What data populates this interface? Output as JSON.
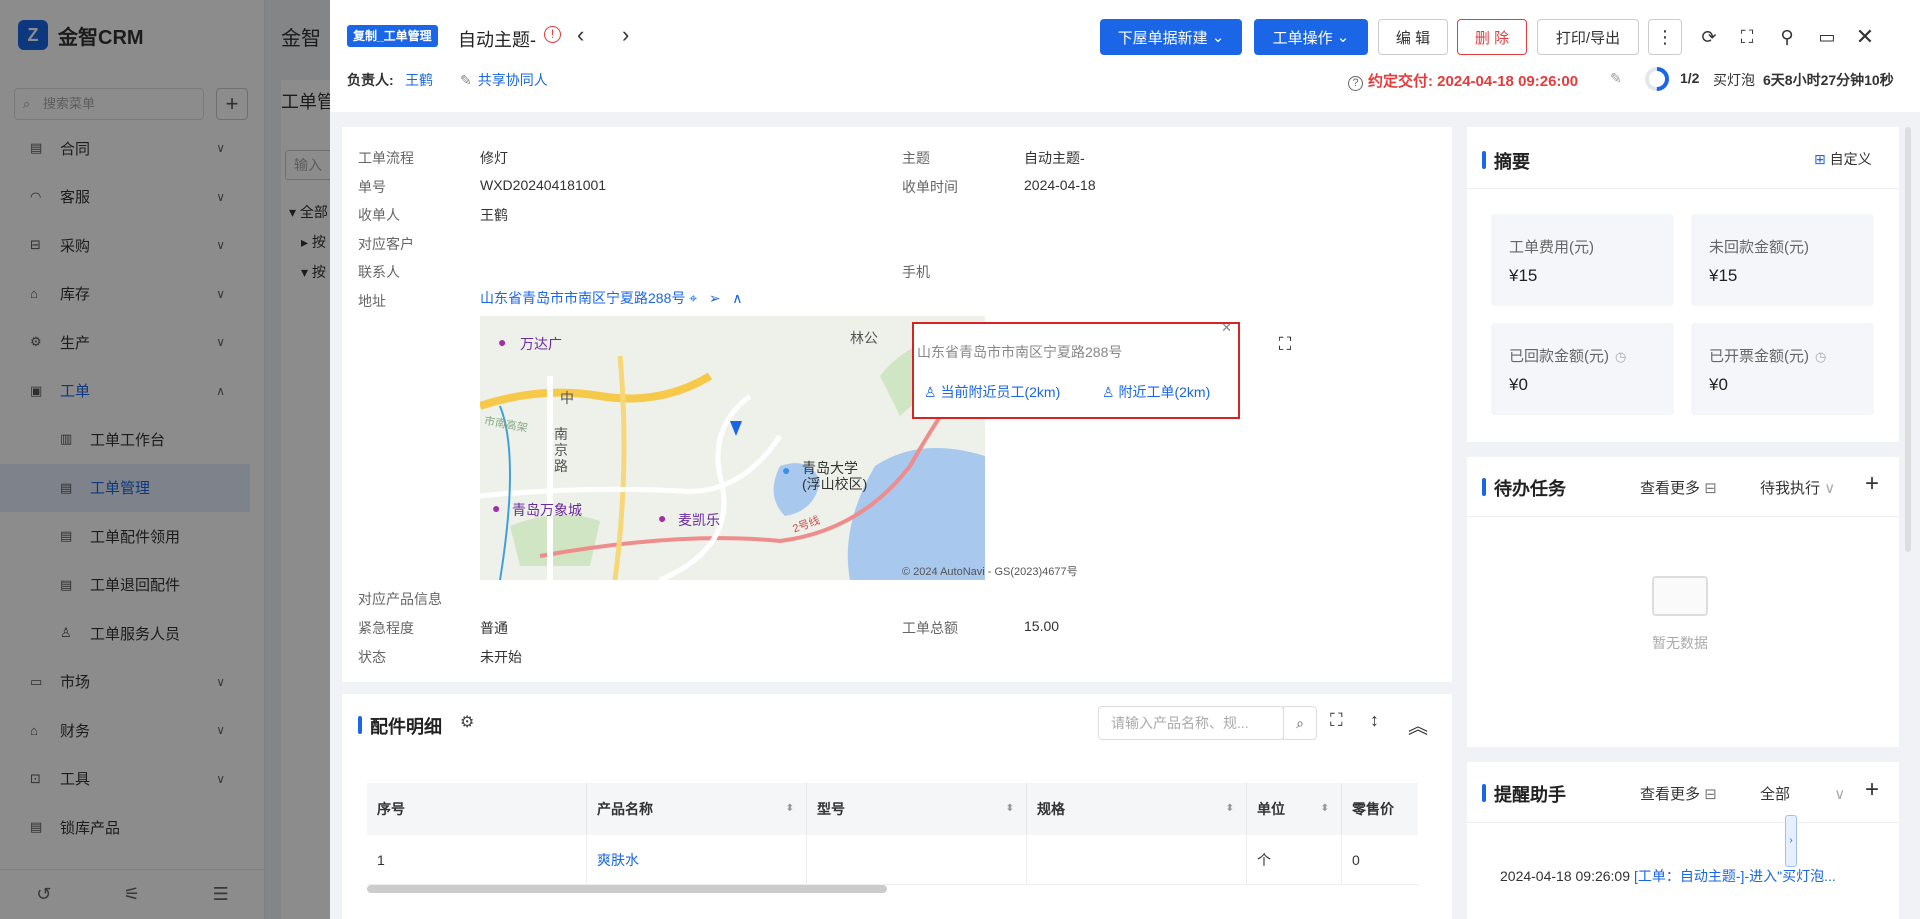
{
  "app": {
    "logo_text": "金智CRM",
    "logo_letter": "Z",
    "search_placeholder": "搜索菜单"
  },
  "sidebar": {
    "items": [
      {
        "label": "合同",
        "icon": "contract-icon"
      },
      {
        "label": "客服",
        "icon": "headset-icon"
      },
      {
        "label": "采购",
        "icon": "cart-icon"
      },
      {
        "label": "库存",
        "icon": "warehouse-icon"
      },
      {
        "label": "生产",
        "icon": "gear-icon"
      },
      {
        "label": "工单",
        "icon": "workorder-icon"
      },
      {
        "label": "工单工作台",
        "icon": "workbench-icon"
      },
      {
        "label": "工单管理",
        "icon": "doc-icon"
      },
      {
        "label": "工单配件领用",
        "icon": "parts-icon"
      },
      {
        "label": "工单退回配件",
        "icon": "return-icon"
      },
      {
        "label": "工单服务人员",
        "icon": "person-icon"
      },
      {
        "label": "市场",
        "icon": "market-icon"
      },
      {
        "label": "财务",
        "icon": "finance-icon"
      },
      {
        "label": "工具",
        "icon": "toolbox-icon"
      },
      {
        "label": "锁库产品",
        "icon": "lock-icon"
      }
    ]
  },
  "background": {
    "title": "工单管",
    "header_cut": "金智",
    "tree_input": "输入",
    "tree_all": "全部",
    "tree_a": "按",
    "tree_b": "按"
  },
  "drawer": {
    "tag": "复制_工单管理",
    "title": "自动主题-",
    "owner_label": "负责人:",
    "owner_name": "王鹤",
    "share_label": "共享协同人",
    "buttons": {
      "new_below": "下屋单据新建",
      "ops": "工单操作",
      "edit": "编 辑",
      "delete": "删 除",
      "print": "打印/导出"
    },
    "due_label": "约定交付:",
    "due_value": "2024-04-18 09:26:00",
    "progress": {
      "text": "1/2",
      "stage": "买灯泡",
      "time": "6天8小时27分钟10秒",
      "fraction": 0.5
    }
  },
  "info": {
    "fields": {
      "flow_label": "工单流程",
      "flow_value": "修灯",
      "subject_label": "主题",
      "subject_value": "自动主题-",
      "no_label": "单号",
      "no_value": "WXD202404181001",
      "recv_time_label": "收单时间",
      "recv_time_value": "2024-04-18",
      "receiver_label": "收单人",
      "receiver_value": "王鹤",
      "customer_label": "对应客户",
      "contact_label": "联系人",
      "phone_label": "手机",
      "address_label": "地址",
      "address_value": "山东省青岛市市南区宁夏路288号",
      "product_label": "对应产品信息",
      "urgency_label": "紧急程度",
      "urgency_value": "普通",
      "total_label": "工单总额",
      "total_value": "15.00",
      "status_label": "状态",
      "status_value": "未开始"
    },
    "map": {
      "popup_address": "山东省青岛市市南区宁夏路288号",
      "nearby_staff": "当前附近员工(2km)",
      "nearby_orders": "附近工单(2km)",
      "copyright": "© 2024 AutoNavi - GS(2023)4677号",
      "labels": {
        "wanda": "万达广",
        "zhong": "中",
        "lin": "林公",
        "nanjing_rd": "南京路",
        "qdu": "青岛大学",
        "qdu_sub": "(浮山校区)",
        "wanxiang": "青岛万象城",
        "maikaile": "麦凯乐",
        "line2": "2号线",
        "east": "市南高架"
      }
    }
  },
  "parts": {
    "title": "配件明细",
    "search_placeholder": "请输入产品名称、规...",
    "columns": [
      "序号",
      "产品名称",
      "型号",
      "规格",
      "单位",
      "零售价"
    ],
    "rows": [
      [
        "1",
        "爽肤水",
        "",
        "",
        "个",
        "0"
      ]
    ]
  },
  "summary": {
    "title": "摘要",
    "customize": "自定义",
    "boxes": [
      {
        "label": "工单费用(元)",
        "value": "¥15"
      },
      {
        "label": "未回款金额(元)",
        "value": "¥15"
      },
      {
        "label": "已回款金额(元)",
        "value": "¥0"
      },
      {
        "label": "已开票金额(元)",
        "value": "¥0"
      }
    ]
  },
  "tasks": {
    "title": "待办任务",
    "more": "查看更多",
    "filter": "待我执行",
    "empty": "暂无数据"
  },
  "reminders": {
    "title": "提醒助手",
    "more": "查看更多",
    "filter": "全部",
    "item_time": "2024-04-18 09:26:09",
    "item_text": "[工单：自动主题-]-进入\"买灯泡..."
  }
}
